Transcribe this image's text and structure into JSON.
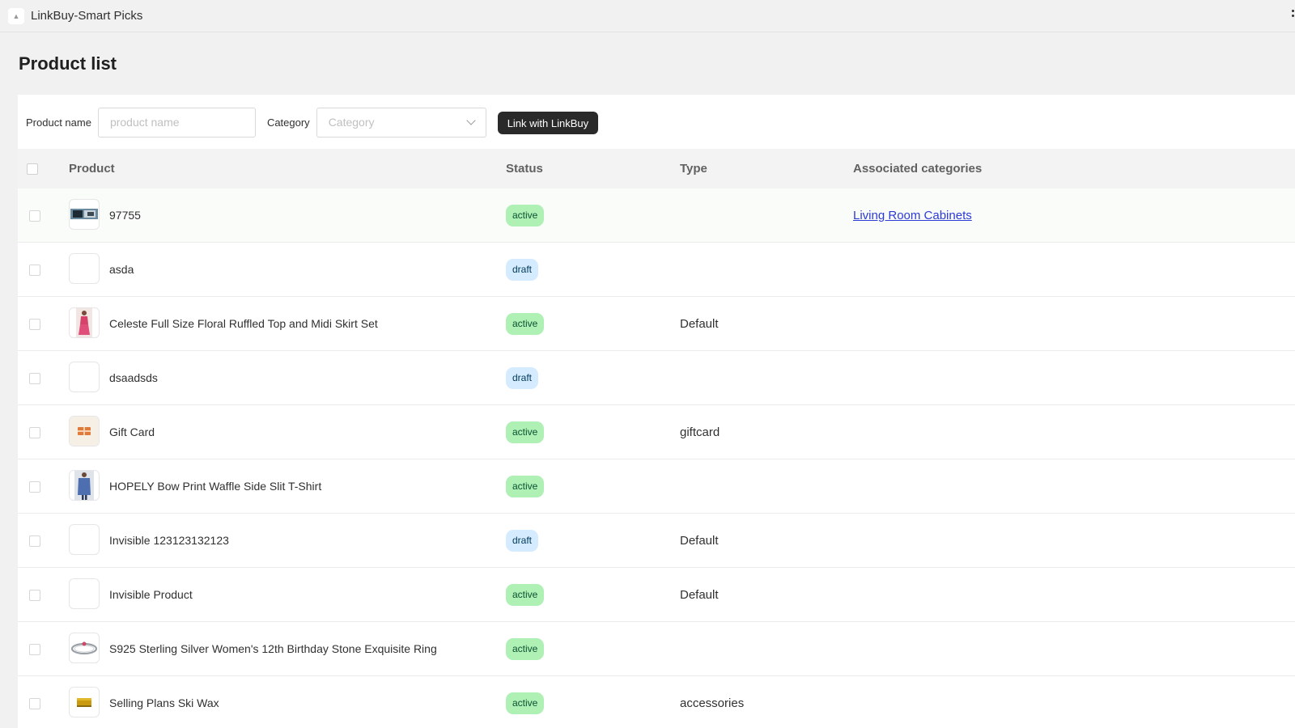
{
  "app": {
    "title": "LinkBuy-Smart Picks",
    "icon": "app-logo-icon"
  },
  "page": {
    "title": "Product list"
  },
  "filters": {
    "product_name_label": "Product name",
    "product_name_placeholder": "product name",
    "product_name_value": "",
    "category_label": "Category",
    "category_placeholder": "Category",
    "link_button": "Link with LinkBuy"
  },
  "table": {
    "columns": {
      "product": "Product",
      "status": "Status",
      "type": "Type",
      "categories": "Associated categories"
    },
    "rows": [
      {
        "name": "97755",
        "status": "active",
        "type": "",
        "category": "Living Room Cabinets",
        "image": "photo"
      },
      {
        "name": "asda",
        "status": "draft",
        "type": "",
        "category": "",
        "image": "none"
      },
      {
        "name": "Celeste Full Size Floral Ruffled Top and Midi Skirt Set",
        "status": "active",
        "type": "Default",
        "category": "",
        "image": "dress"
      },
      {
        "name": "dsaadsds",
        "status": "draft",
        "type": "",
        "category": "",
        "image": "none"
      },
      {
        "name": "Gift Card",
        "status": "active",
        "type": "giftcard",
        "category": "",
        "image": "giftcard"
      },
      {
        "name": "HOPELY Bow Print Waffle Side Slit T-Shirt",
        "status": "active",
        "type": "",
        "category": "",
        "image": "shirt"
      },
      {
        "name": "Invisible 123123132123",
        "status": "draft",
        "type": "Default",
        "category": "",
        "image": "none"
      },
      {
        "name": "Invisible Product",
        "status": "active",
        "type": "Default",
        "category": "",
        "image": "none"
      },
      {
        "name": "S925 Sterling Silver Women's 12th Birthday Stone Exquisite Ring",
        "status": "active",
        "type": "",
        "category": "",
        "image": "ring"
      },
      {
        "name": "Selling Plans Ski Wax",
        "status": "active",
        "type": "accessories",
        "category": "",
        "image": "wax"
      }
    ]
  },
  "colors": {
    "active_badge": "#aff0b5",
    "draft_badge": "#d5ebff",
    "link": "#2c3ad6",
    "button": "#2a2a2a"
  }
}
